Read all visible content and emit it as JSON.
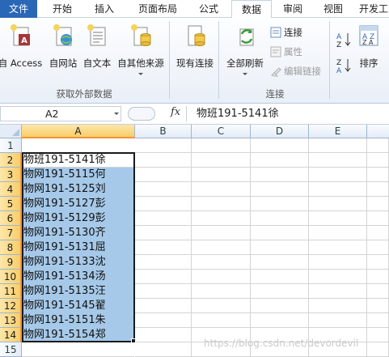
{
  "ribbon": {
    "tabs": [
      "文件",
      "开始",
      "插入",
      "页面布局",
      "公式",
      "数据",
      "审阅",
      "视图",
      "开发工"
    ],
    "active_tab": "数据",
    "get_external_data": {
      "buttons": [
        "自 Access",
        "自网站",
        "自文本",
        "自其他来源"
      ],
      "group_label": "获取外部数据"
    },
    "existing_connections": "现有连接",
    "refresh_all": "全部刷新",
    "connections": {
      "items": [
        "连接",
        "属性",
        "编辑链接"
      ],
      "group_label": "连接"
    },
    "sort": {
      "sort_label": "排序"
    }
  },
  "formula_bar": {
    "name_box": "A2",
    "fx": "fx",
    "content": "物班191-5141徐"
  },
  "grid": {
    "columns": [
      "A",
      "B",
      "C",
      "D",
      "E"
    ],
    "selected_column": "A",
    "rows": [
      "1",
      "2",
      "3",
      "4",
      "5",
      "6",
      "7",
      "8",
      "9",
      "10",
      "11",
      "12",
      "13",
      "14",
      "15"
    ],
    "selected_rows": [
      "2",
      "3",
      "4",
      "5",
      "6",
      "7",
      "8",
      "9",
      "10",
      "11",
      "12",
      "13",
      "14"
    ],
    "cells_A": [
      "",
      "物班191-5141徐",
      "物网191-5115何",
      "物网191-5125刘",
      "物网191-5127彭",
      "物网191-5129彭",
      "物网191-5130齐",
      "物网191-5131屈",
      "物网191-5133沈",
      "物网191-5134汤",
      "物网191-5135汪",
      "物网191-5145翟",
      "物网191-5151朱",
      "物网191-5154郑",
      ""
    ],
    "active_cell": "A2",
    "selection_highlight": "#a6c9e9"
  },
  "watermark": "https://blog.csdn.net/devordevil"
}
